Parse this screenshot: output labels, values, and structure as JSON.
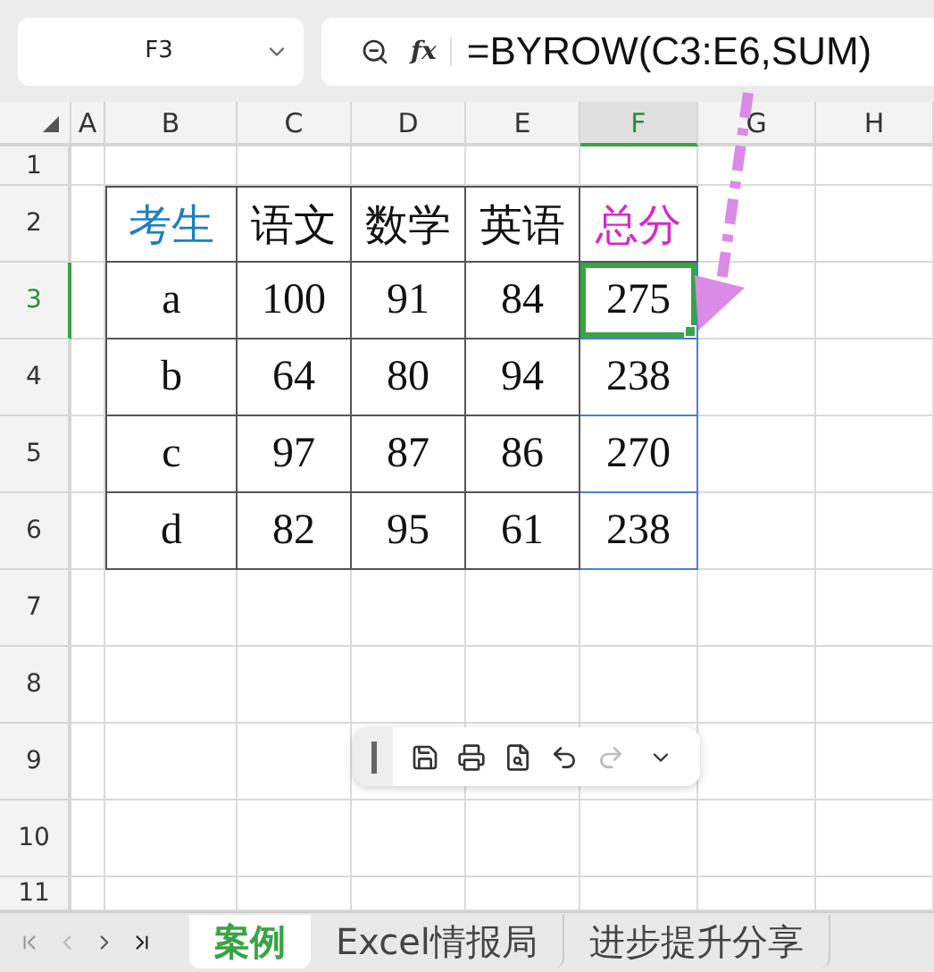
{
  "name_box": {
    "value": "F3"
  },
  "formula_bar": {
    "fx": "fx",
    "value": "=BYROW(C3:E6,SUM)"
  },
  "columns": [
    {
      "label": "A",
      "selected": false
    },
    {
      "label": "B",
      "selected": false
    },
    {
      "label": "C",
      "selected": false
    },
    {
      "label": "D",
      "selected": false
    },
    {
      "label": "E",
      "selected": false
    },
    {
      "label": "F",
      "selected": true
    },
    {
      "label": "G",
      "selected": false
    },
    {
      "label": "H",
      "selected": false
    }
  ],
  "rows": [
    {
      "label": "1",
      "selected": false
    },
    {
      "label": "2",
      "selected": false
    },
    {
      "label": "3",
      "selected": true
    },
    {
      "label": "4",
      "selected": false
    },
    {
      "label": "5",
      "selected": false
    },
    {
      "label": "6",
      "selected": false
    },
    {
      "label": "7",
      "selected": false
    },
    {
      "label": "8",
      "selected": false
    },
    {
      "label": "9",
      "selected": false
    },
    {
      "label": "10",
      "selected": false
    },
    {
      "label": "11",
      "selected": false
    }
  ],
  "table": {
    "spill_outline": true,
    "header": [
      {
        "text": "考生",
        "color": "#1f7fc1"
      },
      {
        "text": "语文",
        "color": "#111111"
      },
      {
        "text": "数学",
        "color": "#111111"
      },
      {
        "text": "英语",
        "color": "#111111"
      },
      {
        "text": "总分",
        "color": "#d629c8"
      }
    ],
    "rows": [
      {
        "cells": [
          {
            "text": "a",
            "selected": false
          },
          {
            "text": "100",
            "selected": false
          },
          {
            "text": "91",
            "selected": false
          },
          {
            "text": "84",
            "selected": false
          },
          {
            "text": "275",
            "selected": true
          }
        ]
      },
      {
        "cells": [
          {
            "text": "b",
            "selected": false
          },
          {
            "text": "64",
            "selected": false
          },
          {
            "text": "80",
            "selected": false
          },
          {
            "text": "94",
            "selected": false
          },
          {
            "text": "238",
            "selected": false
          }
        ]
      },
      {
        "cells": [
          {
            "text": "c",
            "selected": false
          },
          {
            "text": "97",
            "selected": false
          },
          {
            "text": "87",
            "selected": false
          },
          {
            "text": "86",
            "selected": false
          },
          {
            "text": "270",
            "selected": false
          }
        ]
      },
      {
        "cells": [
          {
            "text": "d",
            "selected": false
          },
          {
            "text": "82",
            "selected": false
          },
          {
            "text": "95",
            "selected": false
          },
          {
            "text": "61",
            "selected": false
          },
          {
            "text": "238",
            "selected": false
          }
        ]
      }
    ]
  },
  "toolbar": {
    "redo_disabled": true
  },
  "sheet_tabs": [
    {
      "label": "案例",
      "selected": true
    },
    {
      "label": "Excel情报局",
      "selected": false
    },
    {
      "label": "进步提升分享",
      "selected": false
    }
  ]
}
